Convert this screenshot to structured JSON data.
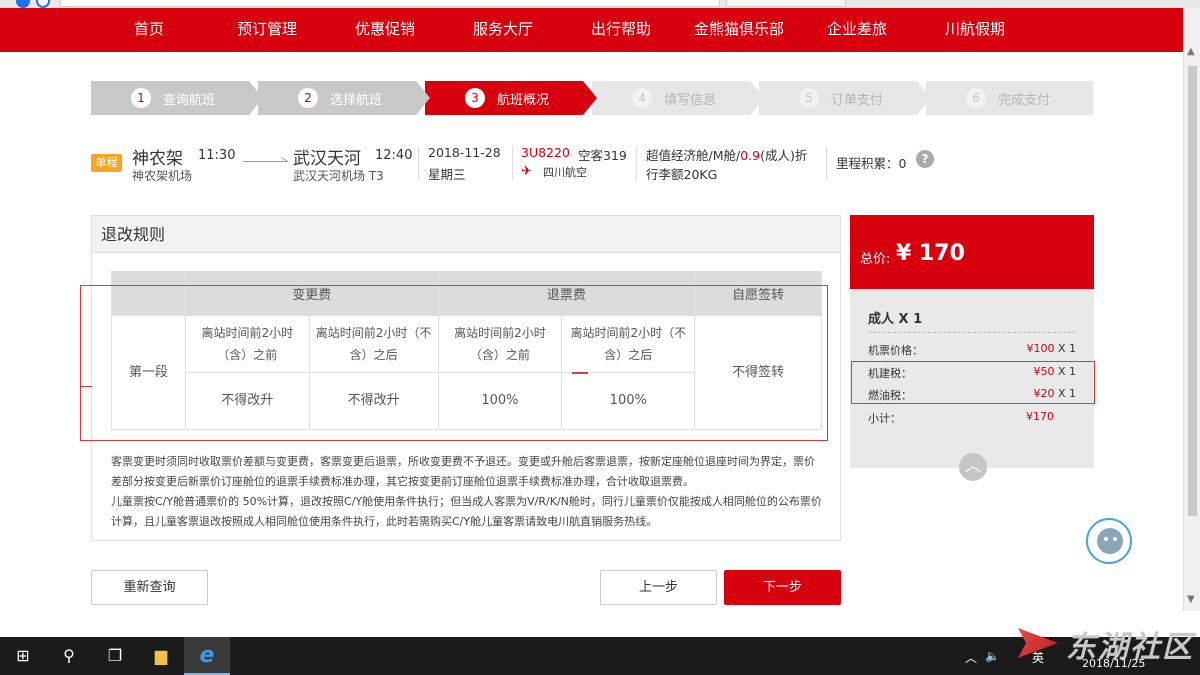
{
  "nav": [
    "首页",
    "预订管理",
    "优惠促销",
    "服务大厅",
    "出行帮助",
    "金熊猫俱乐部",
    "企业差旅",
    "川航假期"
  ],
  "steps": [
    {
      "num": "1",
      "label": "查询航班",
      "state": "done"
    },
    {
      "num": "2",
      "label": "选择航班",
      "state": "done"
    },
    {
      "num": "3",
      "label": "航班概况",
      "state": "current"
    },
    {
      "num": "4",
      "label": "填写信息",
      "state": "todo"
    },
    {
      "num": "5",
      "label": "订单支付",
      "state": "todo"
    },
    {
      "num": "6",
      "label": "完成支付",
      "state": "todo"
    }
  ],
  "flight": {
    "badge": "单程",
    "dep_city": "神农架",
    "dep_time": "11:30",
    "dep_airport": "神农架机场",
    "arr_city": "武汉天河",
    "arr_time": "12:40",
    "arr_airport": "武汉天河机场  T3",
    "date": "2018-11-28",
    "weekday": "星期三",
    "flight_no": "3U8220",
    "aircraft": "空客319",
    "airline": "四川航空",
    "cabin_a": "超值经济舱/M舱/",
    "cabin_discount": "0.9",
    "cabin_b": "(成人)折",
    "baggage": "行李额20KG",
    "mileage": "里程积累：0"
  },
  "rules": {
    "title": "退改规则",
    "col_change": "变更费",
    "col_refund": "退票费",
    "col_endorse": "自愿签转",
    "sub_before": "离站时间前2小时（含）之前",
    "sub_after": "离站时间前2小时（不含）之后",
    "segment": "第一段",
    "change_before": "不得改升",
    "change_after": "不得改升",
    "refund_before": "100%",
    "refund_after": "100%",
    "endorse": "不得签转",
    "note1": "客票变更时须同时收取票价差额与变更费，客票变更后退票，所收变更费不予退还。变更或升舱后客票退票，按新定座舱位退座时间为界定，票价差部分按变更后新票价订座舱位的退票手续费标准办理，其它按变更前订座舱位退票手续费标准办理，合计收取退票费。",
    "note2": "儿童票按C/Y舱普通票价的 50%计算，退改按照C/Y舱使用条件执行；但当成人客票为V/R/K/N舱时，同行儿童票价仅能按成人相同舱位的公布票价计算，且儿童客票退改按照成人相同舱位使用条件执行，此时若需购买C/Y舱儿童客票请致电川航直销服务热线。"
  },
  "price": {
    "total_label": "总价:",
    "total_amount": "¥ 170",
    "pax": "成人 X 1",
    "rows": [
      {
        "label": "机票价格：",
        "value": "¥100",
        "qty": "X 1"
      },
      {
        "label": "机建税：",
        "value": "¥50",
        "qty": "X 1"
      },
      {
        "label": "燃油税：",
        "value": "¥20",
        "qty": "X 1"
      },
      {
        "label": "小计：",
        "value": "¥170",
        "qty": ""
      }
    ]
  },
  "buttons": {
    "requery": "重新查询",
    "prev": "上一步",
    "next": "下一步"
  },
  "taskbar": {
    "lang": "英",
    "date": "2018/11/25"
  },
  "watermark": "东湖社区",
  "colors": {
    "brand": "#d7000f",
    "annotation": "#e2363c"
  }
}
